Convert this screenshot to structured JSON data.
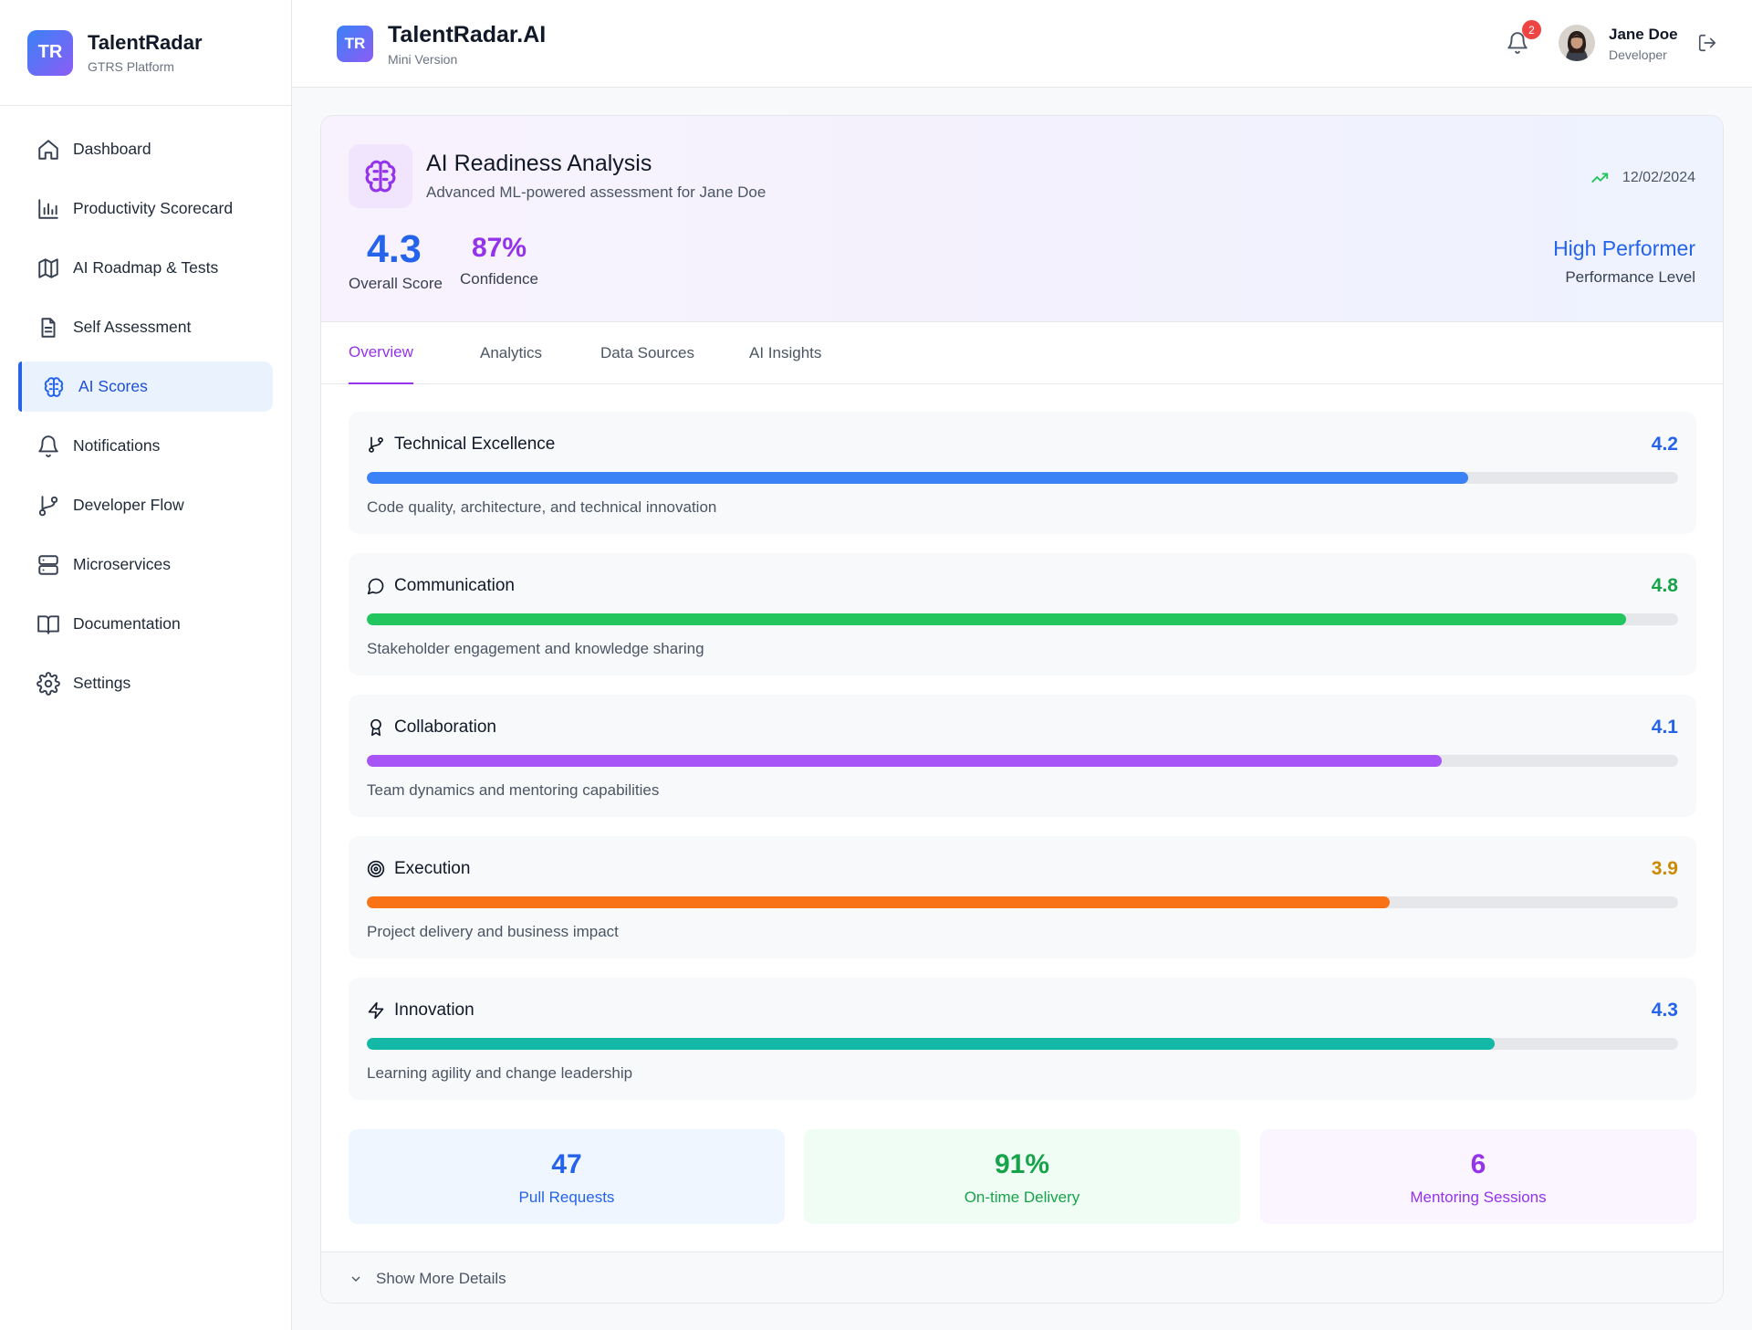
{
  "sidebar": {
    "logo_text": "TR",
    "brand_name": "TalentRadar",
    "brand_sub": "GTRS Platform",
    "items": [
      {
        "label": "Dashboard",
        "icon": "home-icon"
      },
      {
        "label": "Productivity Scorecard",
        "icon": "bar-chart-icon"
      },
      {
        "label": "AI Roadmap & Tests",
        "icon": "map-icon"
      },
      {
        "label": "Self Assessment",
        "icon": "document-icon"
      },
      {
        "label": "AI Scores",
        "icon": "brain-icon",
        "active": true
      },
      {
        "label": "Notifications",
        "icon": "bell-icon"
      },
      {
        "label": "Developer Flow",
        "icon": "git-branch-icon"
      },
      {
        "label": "Microservices",
        "icon": "server-icon"
      },
      {
        "label": "Documentation",
        "icon": "book-icon"
      },
      {
        "label": "Settings",
        "icon": "gear-icon"
      }
    ]
  },
  "header": {
    "logo_text": "TR",
    "title": "TalentRadar.AI",
    "subtitle": "Mini Version",
    "notification_count": "2",
    "user_name": "Jane Doe",
    "user_role": "Developer"
  },
  "analysis": {
    "title": "AI Readiness Analysis",
    "subtitle": "Advanced ML-powered assessment for Jane Doe",
    "date": "12/02/2024",
    "overall_score": "4.3",
    "overall_label": "Overall Score",
    "confidence": "87%",
    "confidence_label": "Confidence",
    "performance": "High Performer",
    "performance_label": "Performance Level"
  },
  "tabs": [
    "Overview",
    "Analytics",
    "Data Sources",
    "AI Insights"
  ],
  "metrics": [
    {
      "name": "Technical Excellence",
      "score": "4.2",
      "fraction": 0.84,
      "description": "Code quality, architecture, and technical innovation",
      "color": "#3b82f6",
      "score_color": "#2563eb",
      "icon": "git-branch-icon"
    },
    {
      "name": "Communication",
      "score": "4.8",
      "fraction": 0.96,
      "description": "Stakeholder engagement and knowledge sharing",
      "color": "#22c55e",
      "score_color": "#16a34a",
      "icon": "message-circle-icon"
    },
    {
      "name": "Collaboration",
      "score": "4.1",
      "fraction": 0.82,
      "description": "Team dynamics and mentoring capabilities",
      "color": "#a855f7",
      "score_color": "#2563eb",
      "icon": "award-icon"
    },
    {
      "name": "Execution",
      "score": "3.9",
      "fraction": 0.78,
      "description": "Project delivery and business impact",
      "color": "#f97316",
      "score_color": "#ca8a04",
      "icon": "target-icon"
    },
    {
      "name": "Innovation",
      "score": "4.3",
      "fraction": 0.86,
      "description": "Learning agility and change leadership",
      "color": "#14b8a6",
      "score_color": "#2563eb",
      "icon": "zap-icon"
    }
  ],
  "stats": [
    {
      "value": "47",
      "label": "Pull Requests",
      "bg": "#eff6ff",
      "color": "#2563eb"
    },
    {
      "value": "91%",
      "label": "On-time Delivery",
      "bg": "#f0fdf4",
      "color": "#16a34a"
    },
    {
      "value": "6",
      "label": "Mentoring Sessions",
      "bg": "#faf5ff",
      "color": "#9333ea"
    }
  ],
  "footer": {
    "label": "Show More Details"
  }
}
